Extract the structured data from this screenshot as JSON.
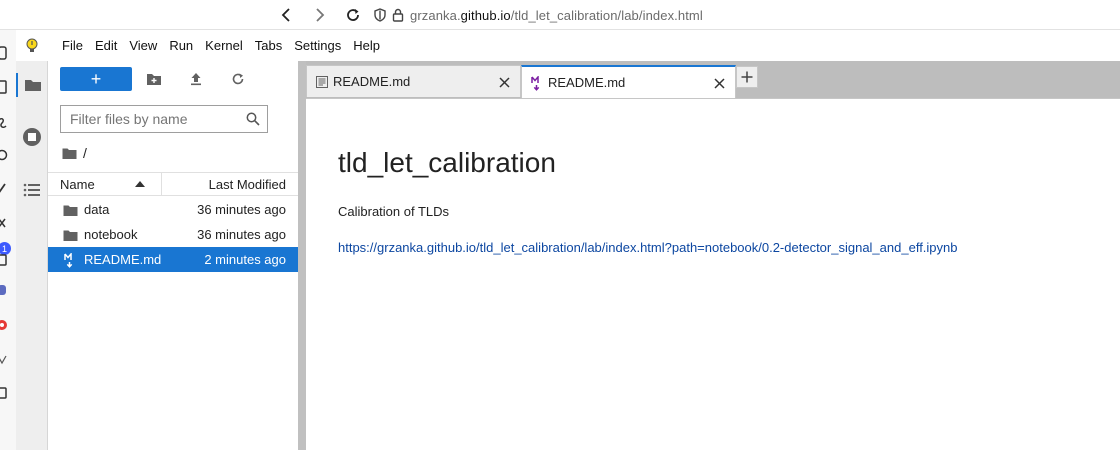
{
  "browser": {
    "url_prefix": "grzanka.",
    "url_host": "github.io",
    "url_path": "/tld_let_calibration/lab/index.html",
    "strip_badge": "1"
  },
  "menu": [
    "File",
    "Edit",
    "View",
    "Run",
    "Kernel",
    "Tabs",
    "Settings",
    "Help"
  ],
  "filebrowser": {
    "new_label": "+",
    "filter_placeholder": "Filter files by name",
    "breadcrumb": "/",
    "col_name": "Name",
    "col_modified": "Last Modified",
    "rows": [
      {
        "name": "data",
        "modified": "36 minutes ago",
        "type": "folder"
      },
      {
        "name": "notebook",
        "modified": "36 minutes ago",
        "type": "folder"
      },
      {
        "name": "README.md",
        "modified": "2 minutes ago",
        "type": "markdown",
        "selected": true
      }
    ]
  },
  "tabs": [
    {
      "label": "README.md",
      "icon": "text-file-icon",
      "active": false
    },
    {
      "label": "README.md",
      "icon": "markdown-icon",
      "active": true
    }
  ],
  "document": {
    "title": "tld_let_calibration",
    "paragraph": "Calibration of TLDs",
    "link": "https://grzanka.github.io/tld_let_calibration/lab/index.html?path=notebook/0.2-detector_signal_and_eff.ipynb"
  },
  "colors": {
    "accent": "#1976d2",
    "link": "#0d47a1",
    "markdown_icon": "#7b1fa2"
  }
}
